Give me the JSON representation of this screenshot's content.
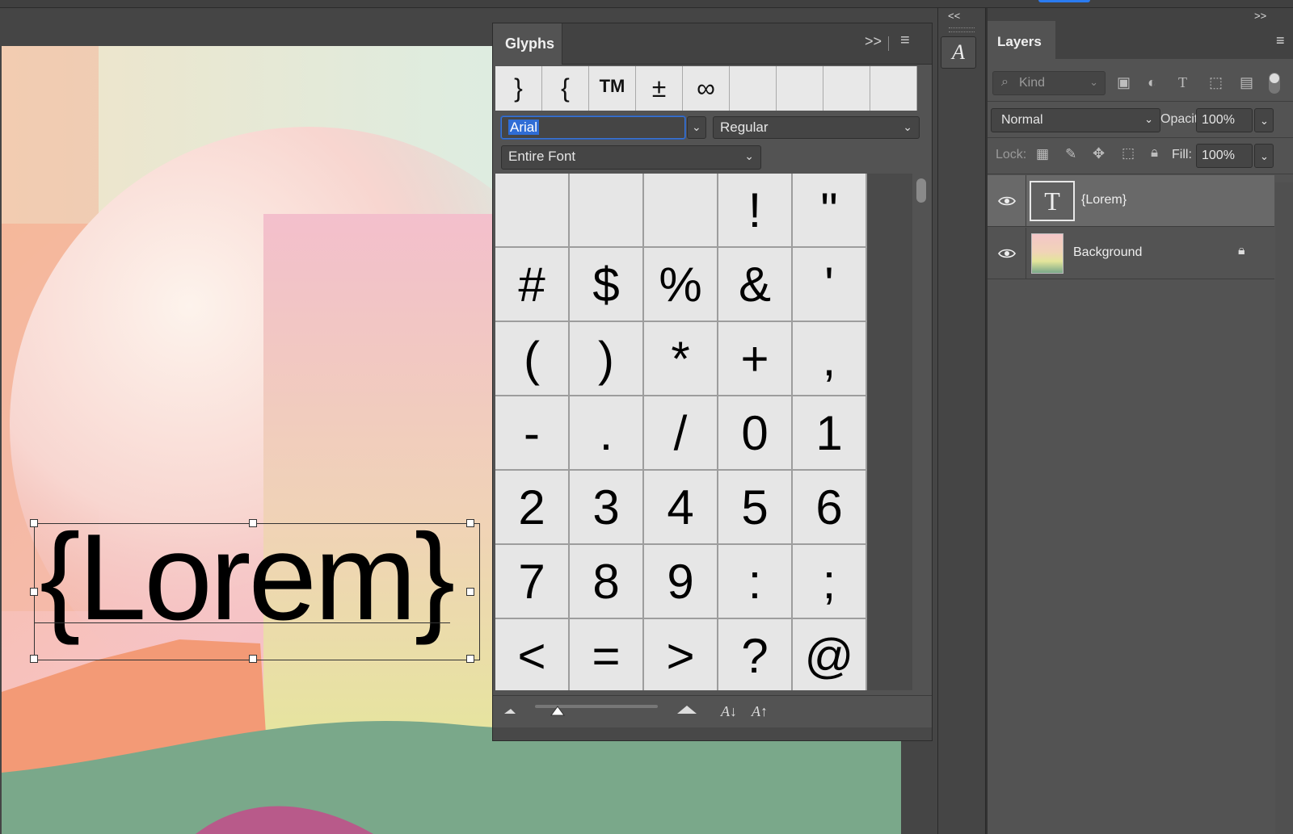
{
  "canvas": {
    "text_layer": "{Lorem}"
  },
  "glyphs_panel": {
    "tab_label": "Glyphs",
    "expand_glyph": ">>",
    "recent_glyphs": [
      "}",
      "{",
      "TM",
      "±",
      "∞",
      "",
      "",
      "",
      ""
    ],
    "font_family": "Arial",
    "font_style": "Regular",
    "range": "Entire Font",
    "glyphs": [
      "",
      "",
      "",
      "!",
      "\"",
      "#",
      "$",
      "%",
      "&",
      "'",
      "(",
      ")",
      "*",
      "+",
      ",",
      "-",
      ".",
      "/",
      "0",
      "1",
      "2",
      "3",
      "4",
      "5",
      "6",
      "7",
      "8",
      "9",
      ":",
      ";",
      "<",
      "=",
      ">",
      "?",
      "@"
    ]
  },
  "layers_panel": {
    "tab_label": "Layers",
    "collapse_left": "<<",
    "collapse_right": ">>",
    "filter_placeholder": "Kind",
    "blend_mode": "Normal",
    "opacity_label": "Opacity:",
    "opacity_value": "100%",
    "lock_label": "Lock:",
    "fill_label": "Fill:",
    "fill_value": "100%",
    "layers": [
      {
        "name": "{Lorem}",
        "type": "text",
        "visible": true,
        "selected": true,
        "thumb_glyph": "T"
      },
      {
        "name": "Background",
        "type": "image",
        "visible": true,
        "selected": false,
        "locked": true
      }
    ]
  },
  "colors": {
    "panel_bg": "#535353",
    "selection_blue": "#2f6dd6",
    "selected_layer": "#696969"
  }
}
